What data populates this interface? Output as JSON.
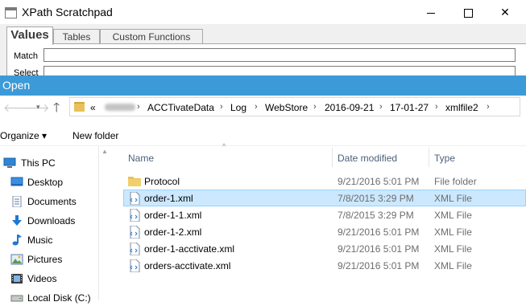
{
  "scratchpad": {
    "title": "XPath Scratchpad",
    "tabs": [
      "Values",
      "Tables",
      "Custom Functions"
    ],
    "match_label": "Match",
    "match_value": "",
    "select_label": "Select",
    "select_value": ""
  },
  "open_dialog": {
    "title": "Open",
    "breadcrumbs": [
      "ACCTivateData",
      "Log",
      "WebStore",
      "2016-09-21",
      "17-01-27",
      "xmlfile2"
    ],
    "overflow_marker": "«",
    "toolbar": {
      "organize_label": "Organize ▾",
      "new_folder_label": "New folder"
    },
    "nav_pane": [
      {
        "label": "This PC",
        "icon": "computer-icon"
      },
      {
        "label": "Desktop",
        "icon": "desktop-icon"
      },
      {
        "label": "Documents",
        "icon": "documents-icon"
      },
      {
        "label": "Downloads",
        "icon": "downloads-icon"
      },
      {
        "label": "Music",
        "icon": "music-icon"
      },
      {
        "label": "Pictures",
        "icon": "pictures-icon"
      },
      {
        "label": "Videos",
        "icon": "videos-icon"
      },
      {
        "label": "Local Disk (C:)",
        "icon": "drive-icon"
      }
    ],
    "columns": [
      "Name",
      "Date modified",
      "Type"
    ],
    "files": [
      {
        "name": "Protocol",
        "date": "9/21/2016 5:01 PM",
        "type": "File folder",
        "icon": "folder-icon"
      },
      {
        "name": "order-1.xml",
        "date": "7/8/2015 3:29 PM",
        "type": "XML File",
        "icon": "xml-file-icon",
        "selected": true
      },
      {
        "name": "order-1-1.xml",
        "date": "7/8/2015 3:29 PM",
        "type": "XML File",
        "icon": "xml-file-icon"
      },
      {
        "name": "order-1-2.xml",
        "date": "9/21/2016 5:01 PM",
        "type": "XML File",
        "icon": "xml-file-icon"
      },
      {
        "name": "order-1-acctivate.xml",
        "date": "9/21/2016 5:01 PM",
        "type": "XML File",
        "icon": "xml-file-icon"
      },
      {
        "name": "orders-acctivate.xml",
        "date": "9/21/2016 5:01 PM",
        "type": "XML File",
        "icon": "xml-file-icon"
      }
    ]
  },
  "colors": {
    "title_bar": "#3c9ad8",
    "selection_fill": "#cce8ff",
    "selection_border": "#99d1ff",
    "column_header_text": "#4c607a"
  }
}
